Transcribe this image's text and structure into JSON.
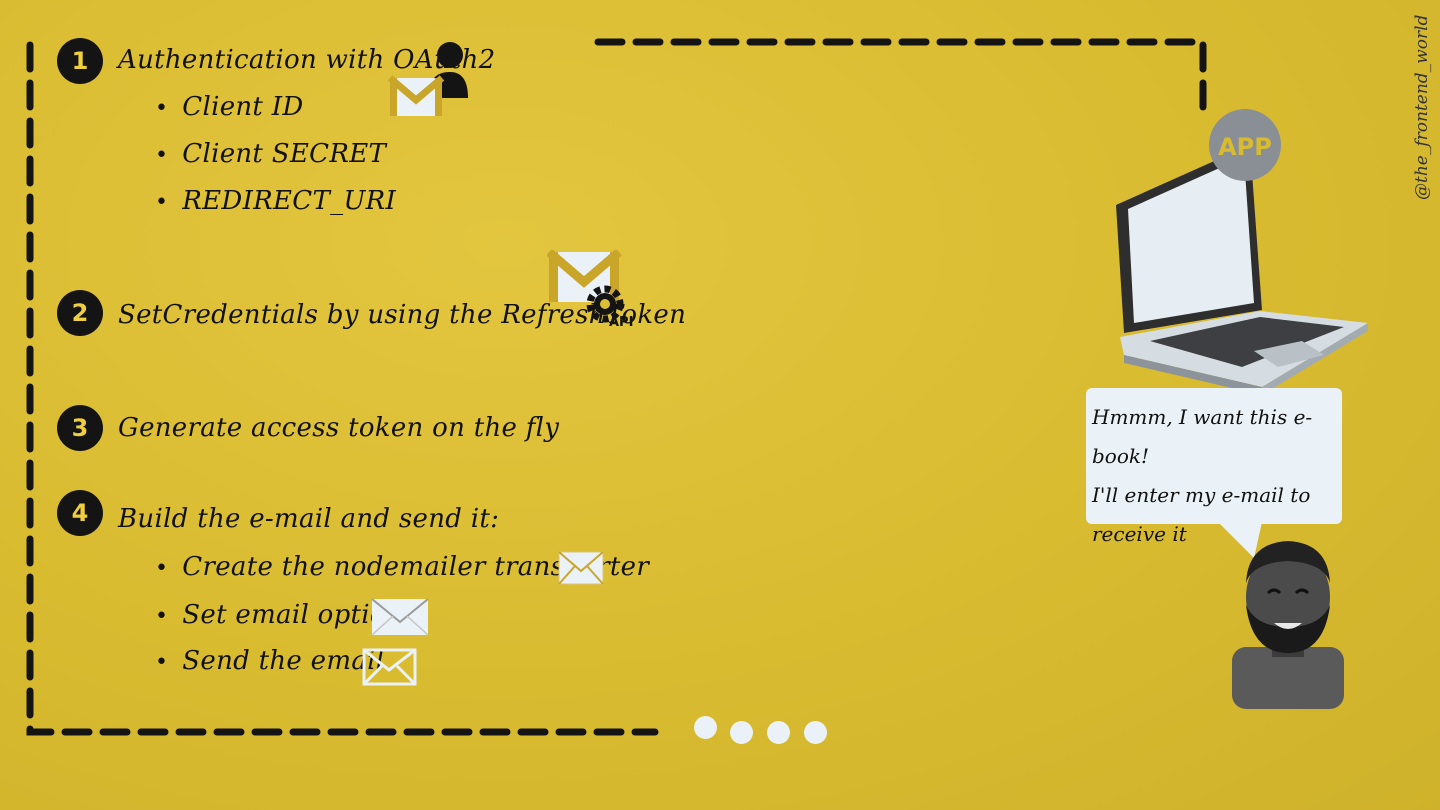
{
  "watermark": "@the_frontend_world",
  "steps": [
    {
      "number": "1",
      "title": "Authentication with OAuth2",
      "bullets": [
        "Client ID",
        "Client SECRET",
        "REDIRECT_URI"
      ]
    },
    {
      "number": "2",
      "title": "SetCredentials by using the RefreshToken",
      "bullets": []
    },
    {
      "number": "3",
      "title": "Generate access token on the fly",
      "bullets": []
    },
    {
      "number": "4",
      "title": "Build the e-mail and send it:",
      "bullets": [
        "Create the nodemailer transporter",
        "Set email options",
        "Send the email"
      ]
    }
  ],
  "api_badge": "API",
  "app_badge": "APP",
  "speech_bubble": {
    "line1": "Hmmm, I want this e-book!",
    "line2": " I'll enter my e-mail to",
    "line3": "receive it"
  },
  "pagination": {
    "dots": 4,
    "active": 0
  },
  "colors": {
    "background": "#dcbe32",
    "ink": "#141414",
    "light": "#eaf2f7",
    "accent": "#f0cf3c"
  }
}
